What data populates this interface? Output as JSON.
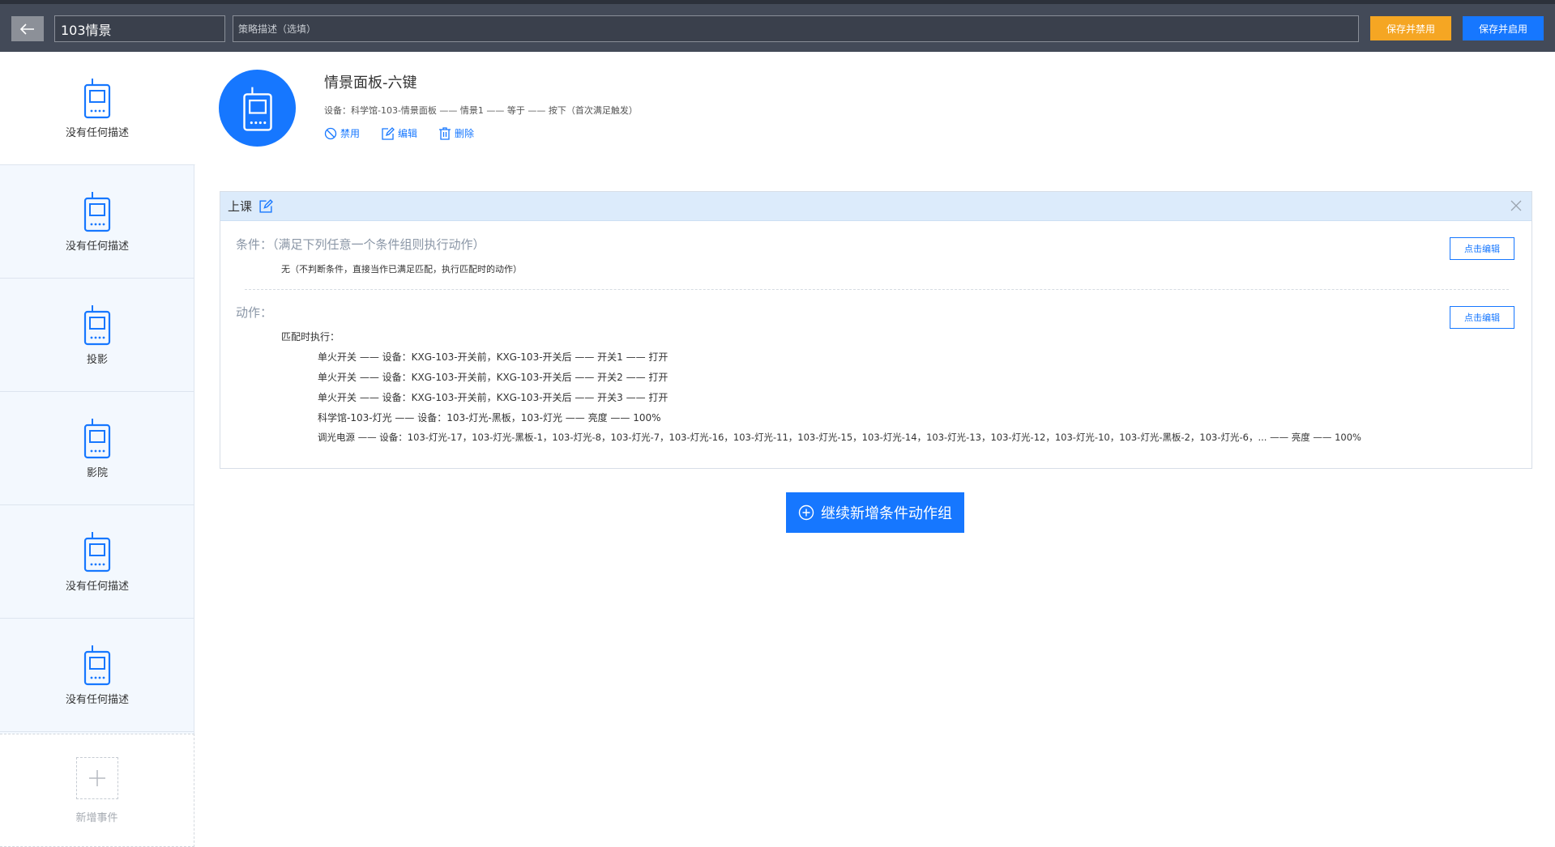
{
  "topbar": {
    "title_value": "103情景",
    "desc_placeholder": "策略描述（选填）",
    "save_disable_label": "保存并禁用",
    "save_enable_label": "保存并启用",
    "colors": {
      "bar": "#434a58",
      "orange": "#f5a623",
      "blue": "#1677ff"
    }
  },
  "sidebar": {
    "items": [
      {
        "label": "没有任何描述",
        "icon": "panel-device-icon"
      },
      {
        "label": "没有任何描述",
        "icon": "panel-device-icon"
      },
      {
        "label": "投影",
        "icon": "panel-device-icon"
      },
      {
        "label": "影院",
        "icon": "panel-device-icon"
      },
      {
        "label": "没有任何描述",
        "icon": "panel-device-icon"
      },
      {
        "label": "没有任何描述",
        "icon": "panel-device-icon"
      }
    ],
    "add_label": "新增事件"
  },
  "device": {
    "title": "情景面板-六键",
    "desc": "设备：科学馆-103-情景面板 —— 情景1 —— 等于 —— 按下（首次满足触发）",
    "disable_label": "禁用",
    "edit_label": "编辑",
    "delete_label": "删除"
  },
  "group": {
    "name": "上课",
    "condition_title": "条件：（满足下列任意一个条件组则执行动作）",
    "condition_text": "无（不判断条件，直接当作已满足匹配，执行匹配时的动作）",
    "edit_btn_label": "点击编辑",
    "action_title": "动作：",
    "match_label": "匹配时执行：",
    "actions": [
      "单火开关 —— 设备：KXG-103-开关前，KXG-103-开关后 —— 开关1 —— 打开",
      "单火开关 —— 设备：KXG-103-开关前，KXG-103-开关后 —— 开关2 —— 打开",
      "单火开关 —— 设备：KXG-103-开关前，KXG-103-开关后 —— 开关3 —— 打开",
      "科学馆-103-灯光 —— 设备：103-灯光-黑板，103-灯光 —— 亮度 —— 100%",
      "调光电源 —— 设备：103-灯光-17，103-灯光-黑板-1，103-灯光-8，103-灯光-7，103-灯光-16，103-灯光-11，103-灯光-15，103-灯光-14，103-灯光-13，103-灯光-12，103-灯光-10，103-灯光-黑板-2，103-灯光-6，... —— 亮度 —— 100%"
    ]
  },
  "add_group_label": "继续新增条件动作组"
}
